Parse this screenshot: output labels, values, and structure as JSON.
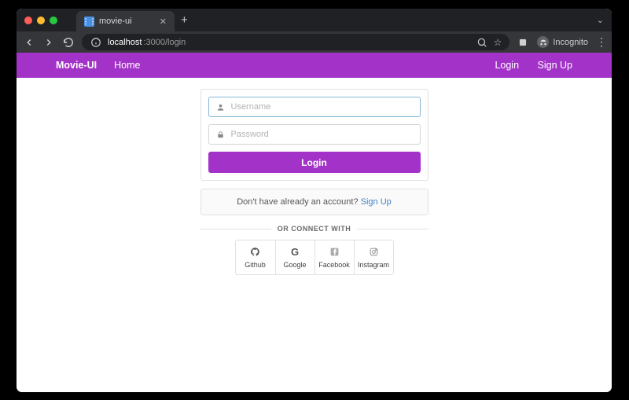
{
  "browser": {
    "tab_title": "movie-ui",
    "url_prefix": "localhost",
    "url_path": ":3000/login",
    "incognito_label": "Incognito"
  },
  "navbar": {
    "brand": "Movie-UI",
    "home": "Home",
    "login": "Login",
    "signup": "Sign Up"
  },
  "form": {
    "username_placeholder": "Username",
    "password_placeholder": "Password",
    "submit_label": "Login"
  },
  "signup_prompt": {
    "text": "Don't have already an account? ",
    "link": "Sign Up"
  },
  "divider_label": "OR CONNECT WITH",
  "social": {
    "github": "Github",
    "google": "Google",
    "facebook": "Facebook",
    "instagram": "Instagram"
  }
}
